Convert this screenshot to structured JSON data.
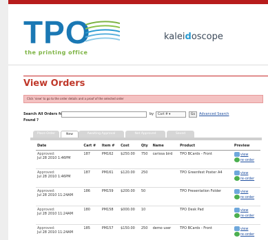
{
  "brand": {
    "logo_text": "TPO",
    "logo_tagline": "the printing office",
    "partner_prefix": "kalei",
    "partner_o": "d",
    "partner_rest": "oscope"
  },
  "page": {
    "title": "View Orders",
    "info_text": "Click 'view' to go to the order details and a proof of the selected order"
  },
  "search": {
    "label": "Search All Orders for:",
    "value": "",
    "by_label": "by",
    "by_option": "Cart #",
    "go_label": "Go",
    "advanced_label": "Advanced Search",
    "found_label": "Found ?"
  },
  "tabs": [
    {
      "label": "Place Order"
    },
    {
      "label": "New"
    },
    {
      "label": "Awaiting Approval"
    },
    {
      "label": "Not Approved"
    },
    {
      "label": "Saved"
    }
  ],
  "table": {
    "headers": [
      "Date",
      "Cart #",
      "Item #",
      "Cost",
      "Qty",
      "Name",
      "Product",
      "Preview"
    ],
    "rows": [
      {
        "status": "Approved:",
        "date": "Jul 28 2010 1:46PM",
        "cart": "187",
        "item": "PM162",
        "cost": "$250.00",
        "qty": "750",
        "name": "carissa bird",
        "product": "TPO BCards - Front"
      },
      {
        "status": "Approved:",
        "date": "Jul 28 2010 1:46PM",
        "cart": "187",
        "item": "PM161",
        "cost": "$120.00",
        "qty": "250",
        "name": "",
        "product": "TPO Greenfest Poster A4"
      },
      {
        "status": "Approved:",
        "date": "Jul 28 2010 11:24AM",
        "cart": "186",
        "item": "PM159",
        "cost": "$200.00",
        "qty": "50",
        "name": "",
        "product": "TPO Presentation Folder"
      },
      {
        "status": "Approved:",
        "date": "Jul 28 2010 11:24AM",
        "cart": "180",
        "item": "PM158",
        "cost": "$000.00",
        "qty": "10",
        "name": "",
        "product": "TPO Desk Pad"
      },
      {
        "status": "Approved:",
        "date": "Jul 28 2010 11:24AM",
        "cart": "185",
        "item": "PM157",
        "cost": "$150.00",
        "qty": "250",
        "name": "demo user",
        "product": "TPO BCards - Front"
      }
    ],
    "view_label": "view",
    "reorder_label": "re-order"
  },
  "colors": {
    "accent_red": "#c0392b",
    "logo_blue": "#1a78b4",
    "link_blue": "#1f4fa0"
  }
}
